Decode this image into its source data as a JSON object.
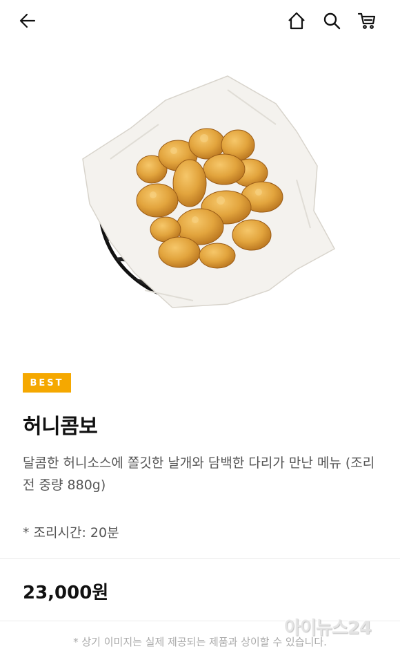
{
  "header": {
    "back_icon": "arrow-left-icon",
    "home_icon": "home-icon",
    "search_icon": "search-icon",
    "cart_icon": "cart-icon"
  },
  "product": {
    "badge": "BEST",
    "badge_color": "#f5a800",
    "name": "허니콤보",
    "description": "달콤한 허니소스에 쫄깃한 날개와 담백한 다리가 만난 메뉴 (조리전 중량 880g)",
    "cook_time": "* 조리시간: 20분",
    "price": "23,000원"
  },
  "footer": {
    "note": "* 상기 이미지는 실제 제공되는 제품과 상이할 수 있습니다.",
    "watermark": "아이뉴스24"
  }
}
